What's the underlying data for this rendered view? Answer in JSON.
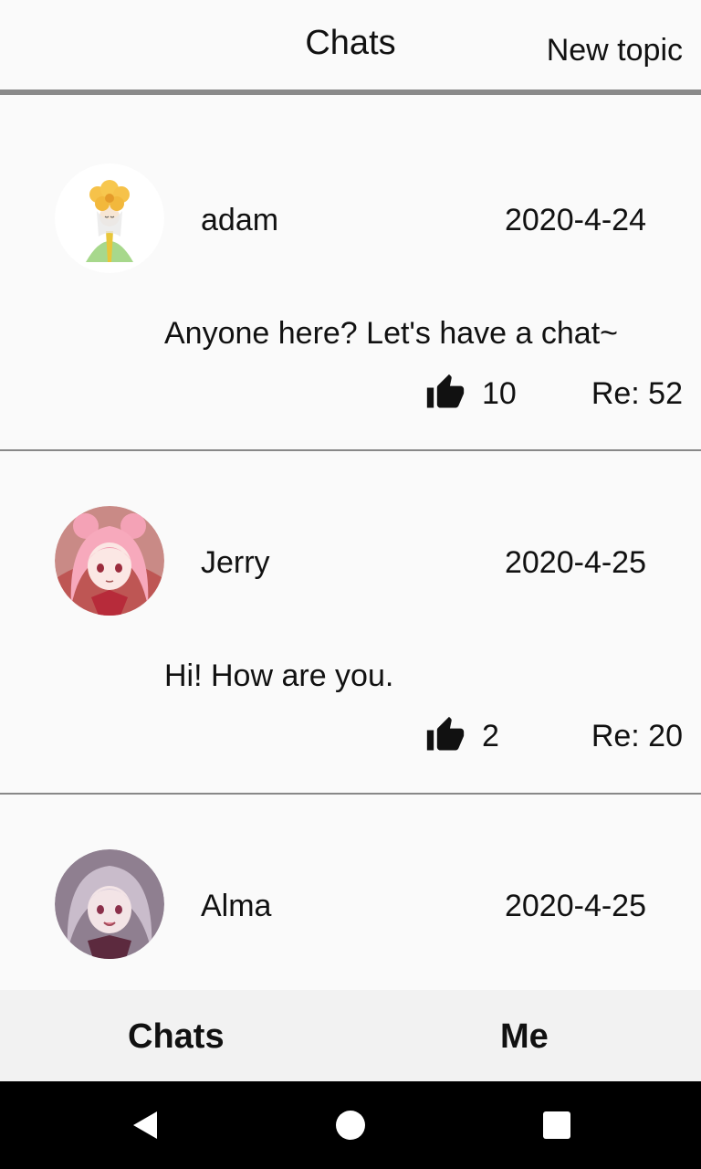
{
  "header": {
    "title": "Chats",
    "new_topic_label": "New topic"
  },
  "posts": [
    {
      "username": "adam",
      "date": "2020-4-24",
      "message": "Anyone here? Let's have a chat~",
      "likes": "10",
      "replies": "Re: 52",
      "avatar_icon": "avatar-flower-girl"
    },
    {
      "username": "Jerry",
      "date": "2020-4-25",
      "message": "Hi! How are you.",
      "likes": "2",
      "replies": "Re: 20",
      "avatar_icon": "avatar-pink-hair-girl"
    },
    {
      "username": "Alma",
      "date": "2020-4-25",
      "message": "",
      "likes": "",
      "replies": "",
      "avatar_icon": "avatar-lilac-hair-girl"
    }
  ],
  "tabs": {
    "chats_label": "Chats",
    "me_label": "Me"
  },
  "colors": {
    "background": "#fafafa",
    "divider": "#888888",
    "tabbar": "#f2f2f2",
    "navbar": "#000000"
  }
}
